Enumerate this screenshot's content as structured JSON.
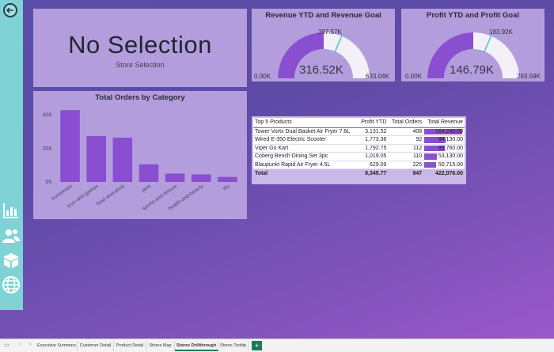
{
  "no_selection": {
    "title": "No Selection",
    "subtitle": "Store Selection"
  },
  "revenue_gauge": {
    "title": "Revenue YTD and Revenue Goal",
    "value_label": "316.52K",
    "target_label": "397.57K",
    "min_label": "0.00K",
    "max_label": "633.04K",
    "value": 316.52,
    "target": 397.57,
    "min": 0,
    "max": 633.04
  },
  "profit_gauge": {
    "title": "Profit YTD and Profit Goal",
    "value_label": "146.79K",
    "target_label": "183.92K",
    "min_label": "0.00K",
    "max_label": "293.59K",
    "value": 146.79,
    "target": 183.92,
    "min": 0,
    "max": 293.59
  },
  "chart_data": {
    "type": "bar",
    "title": "Total Orders by Category",
    "categories": [
      "homeware",
      "toys-and-games",
      "food-and-drink",
      "pets",
      "sports-and-leisure",
      "health-and-beauty",
      "diy"
    ],
    "values": [
      43000,
      27500,
      26500,
      10500,
      5000,
      4500,
      3000
    ],
    "ylim": [
      0,
      45000
    ],
    "yticks": [
      0,
      20000,
      40000
    ],
    "ytick_labels": [
      "0K",
      "20K",
      "40K"
    ],
    "color": "#8a4ed0"
  },
  "table": {
    "headers": [
      "Top 5 Products",
      "Profit YTD",
      "Total Orders",
      "Total Revenue"
    ],
    "rows": [
      [
        "Tower Vortx Dual Basket Air Fryer 7.6L",
        "3,131.52",
        "408",
        "164,243.00"
      ],
      [
        "Wired E-350 Electric Scooter",
        "1,773.36",
        "92",
        "94,130.00"
      ],
      [
        "Viper Go Kart",
        "1,792.75",
        "112",
        "89,760.00"
      ],
      [
        "Coberg Bench Dining Set 3pc",
        "1,019.05",
        "110",
        "53,130.00"
      ],
      [
        "Blaupunkt Rapid Air Fryer 4.5L",
        "629.09",
        "225",
        "50,715.00"
      ]
    ],
    "revenue_values": [
      164243,
      94130,
      89760,
      53130,
      50715
    ],
    "total": [
      "Total",
      "8,345.77",
      "947",
      "422,076.00"
    ]
  },
  "tabs": [
    "Executive Summary",
    "Customer Detail",
    "Product Detail",
    "Stores Map",
    "Stores Drillthrough",
    "Stores Tooltip"
  ],
  "active_tab": "Stores Drillthrough",
  "add_tab": "+",
  "colors": {
    "accent": "#8a4ed0",
    "rail": "#7fd3d6",
    "panel": "#b39ddc",
    "target_line": "#3fc9d4",
    "active_tab": "#1b7a5a"
  }
}
